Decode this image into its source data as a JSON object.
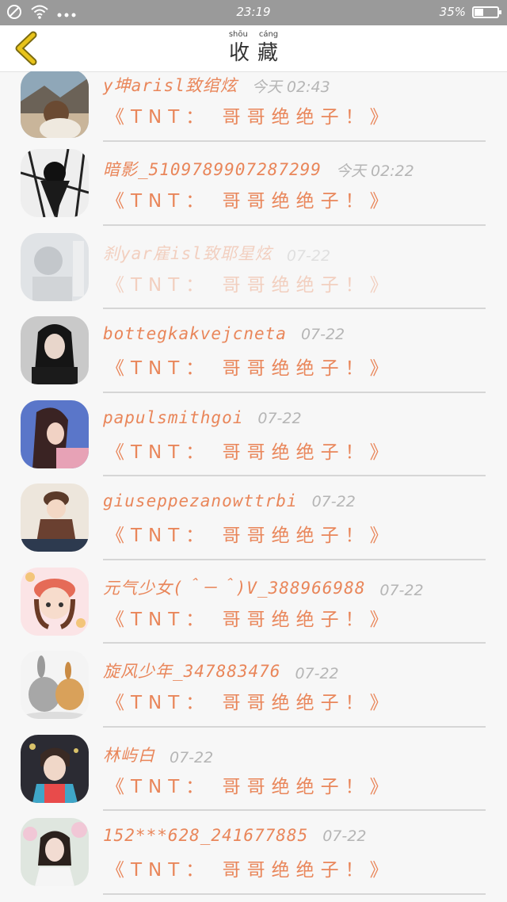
{
  "status_bar": {
    "time": "23:19",
    "battery_percent": "35%",
    "battery_level": 0.35
  },
  "nav": {
    "title": "收藏",
    "title_pinyin": [
      "shōu",
      "cáng"
    ]
  },
  "colors": {
    "accent": "#e9865a",
    "back_icon": "#e8c31a"
  },
  "list": {
    "items": [
      {
        "name": "y坤arisl致绾炫",
        "date": "今天 02:43",
        "message": "《TNT： 哥哥绝绝子！》",
        "avatar": "avatar-landscape-photo"
      },
      {
        "name": "暗影_5109789907287299",
        "date": "今天 02:22",
        "message": "《TNT： 哥哥绝绝子！》",
        "avatar": "avatar-bw-anime"
      },
      {
        "name": "刹yar雇isl致耶星炫",
        "date": "07-22",
        "message": "《TNT： 哥哥绝绝子！》",
        "avatar": "avatar-blurred-portrait"
      },
      {
        "name": "bottegkakvejcneta",
        "date": "07-22",
        "message": "《TNT： 哥哥绝绝子！》",
        "avatar": "avatar-girl-portrait"
      },
      {
        "name": "papulsmithgoi",
        "date": "07-22",
        "message": "《TNT： 哥哥绝绝子！》",
        "avatar": "avatar-anime-girl"
      },
      {
        "name": "giuseppezanowttrbi",
        "date": "07-22",
        "message": "《TNT： 哥哥绝绝子！》",
        "avatar": "avatar-cartoon-boy"
      },
      {
        "name": "元气少女(＾－＾)V_388966988",
        "date": "07-22",
        "message": "《TNT： 哥哥绝绝子！》",
        "avatar": "avatar-cartoon-girl-hat"
      },
      {
        "name": "旋风少年_347883476",
        "date": "07-22",
        "message": "《TNT： 哥哥绝绝子！》",
        "avatar": "avatar-rabbits"
      },
      {
        "name": "林屿白",
        "date": "07-22",
        "message": "《TNT： 哥哥绝绝子！》",
        "avatar": "avatar-boy-photo"
      },
      {
        "name": "152***628_241677885",
        "date": "07-22",
        "message": "《TNT： 哥哥绝绝子！》",
        "avatar": "avatar-girl-flowers"
      }
    ]
  }
}
